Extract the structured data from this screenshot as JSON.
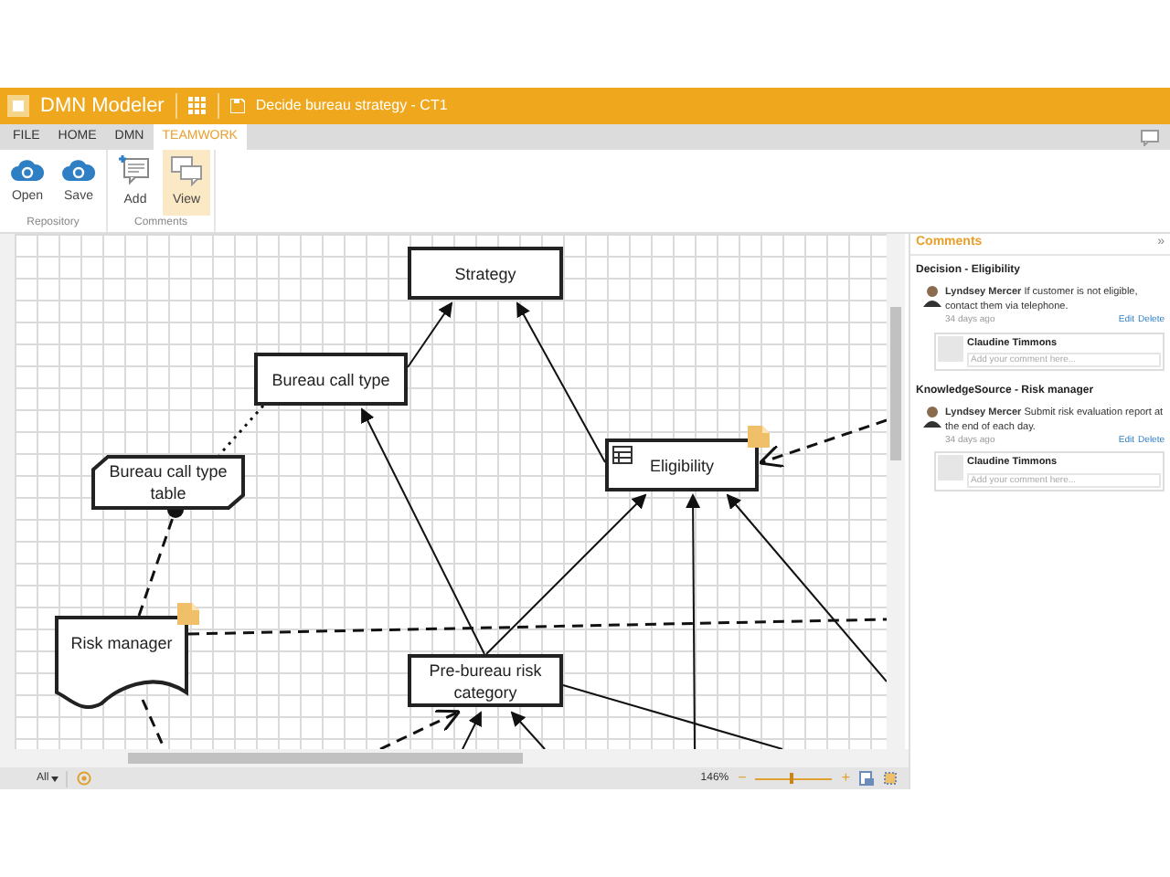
{
  "app": {
    "name": "DMN Modeler",
    "document": "Decide bureau strategy - CT1"
  },
  "menu_tabs": [
    {
      "label": "FILE",
      "selected": false
    },
    {
      "label": "HOME",
      "selected": false
    },
    {
      "label": "DMN",
      "selected": false
    },
    {
      "label": "TEAMWORK",
      "selected": true
    }
  ],
  "ribbon": [
    {
      "group": "Repository",
      "buttons": [
        {
          "label": "Open",
          "selected": false
        },
        {
          "label": "Save",
          "selected": false
        }
      ]
    },
    {
      "group": "Comments",
      "buttons": [
        {
          "label": "Add",
          "selected": false
        },
        {
          "label": "View",
          "selected": true
        }
      ]
    }
  ],
  "diagram": {
    "nodes": [
      {
        "label": "Strategy",
        "kind": "decision",
        "has_table": false,
        "has_note": false
      },
      {
        "label": "Bureau call type",
        "kind": "decision",
        "has_table": false,
        "has_note": false
      },
      {
        "label": "Bureau call type table",
        "kind": "knowledge_model",
        "has_note": false
      },
      {
        "label": "Eligibility",
        "kind": "decision",
        "has_table": true,
        "has_note": true
      },
      {
        "label": "Risk manager",
        "kind": "knowledge_source",
        "has_note": true
      },
      {
        "label": "Pre-bureau risk category",
        "kind": "decision",
        "has_table": false,
        "has_note": false
      }
    ]
  },
  "comments_panel": {
    "title": "Comments",
    "collapse": "»",
    "threads": [
      {
        "heading": "Decision - Eligibility",
        "author": "Lyndsey Mercer",
        "text": "If customer is not eligible, contact them via telephone.",
        "time": "34 days ago",
        "actions": [
          "Edit",
          "Delete"
        ],
        "reply_user": "Claudine Timmons",
        "reply_placeholder": "Add your comment here..."
      },
      {
        "heading": "KnowledgeSource - Risk manager",
        "author": "Lyndsey Mercer",
        "text": "Submit risk evaluation report at the end of each day.",
        "time": "34 days ago",
        "actions": [
          "Edit",
          "Delete"
        ],
        "reply_user": "Claudine Timmons",
        "reply_placeholder": "Add your comment here..."
      }
    ]
  },
  "status_bar": {
    "filter": "All",
    "zoom": "146%",
    "zoom_slider": {
      "level": 0.45
    },
    "minus": "−",
    "plus": "+"
  }
}
